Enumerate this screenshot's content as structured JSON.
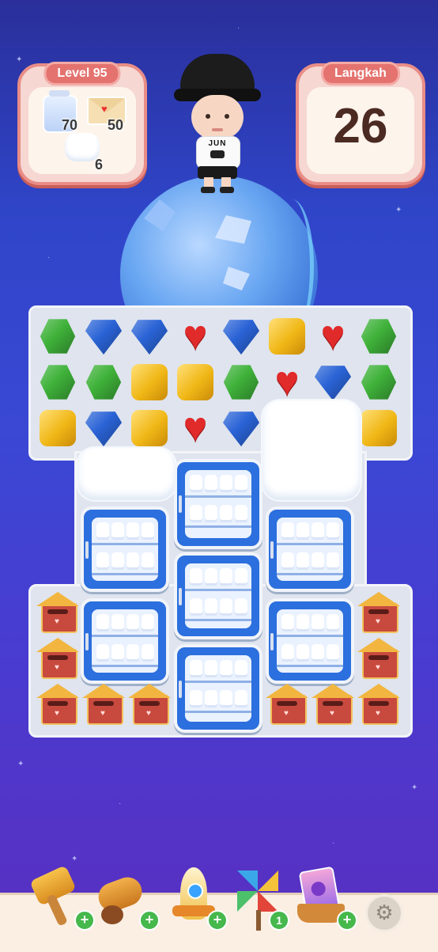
{
  "level_card": {
    "title": "Level 95",
    "goals": [
      {
        "icon": "milk-jar-icon",
        "count": "70"
      },
      {
        "icon": "love-letter-icon",
        "count": "50"
      },
      {
        "icon": "cloud-icon",
        "count": "6"
      }
    ]
  },
  "moves_card": {
    "title": "Langkah",
    "moves": "26"
  },
  "character": {
    "shirt_text": "JUN"
  },
  "board": {
    "colors": {
      "green": "#3fb23a",
      "blue": "#2a63d6",
      "red": "#e12a2a",
      "yellow": "#f0b716"
    },
    "rows": [
      [
        "green",
        "blue",
        "blue",
        "red",
        "blue",
        "yellow",
        "red",
        "green"
      ],
      [
        "green",
        "green",
        "yellow",
        "yellow",
        "green",
        "red",
        "blue",
        "green"
      ],
      [
        "yellow",
        "blue",
        "yellow",
        "red",
        "blue",
        "cloud",
        "cloud",
        "yellow"
      ]
    ]
  },
  "boosters": [
    {
      "name": "hammer-icon",
      "badge": "+"
    },
    {
      "name": "cannon-icon",
      "badge": "+"
    },
    {
      "name": "rocket-icon",
      "badge": "+"
    },
    {
      "name": "pinwheel-icon",
      "badge": "1"
    },
    {
      "name": "cart-icon",
      "badge": "+"
    }
  ]
}
